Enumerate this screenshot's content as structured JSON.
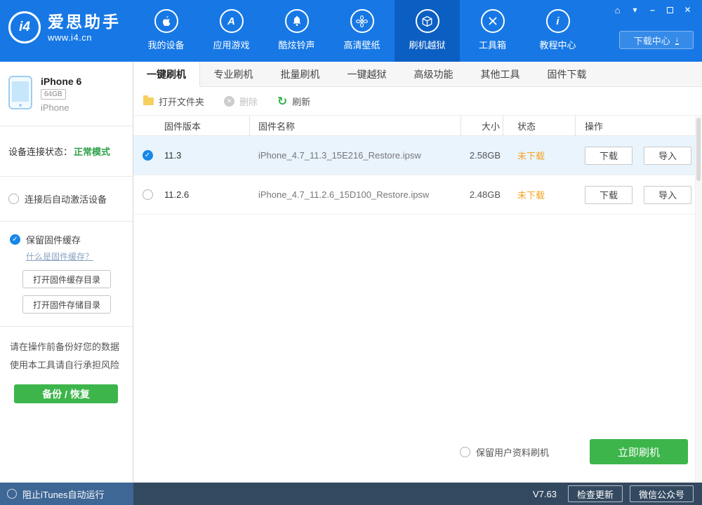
{
  "colors": {
    "topbar": "#1778e5",
    "topbar_active": "#0c5fc2",
    "green": "#3db54b",
    "status_green": "#2fa14b",
    "orange": "#f5a623",
    "selected_row": "#e9f4fd",
    "link": "#8aa4c2"
  },
  "titlebar": {
    "logo_text": "i4",
    "brand": "爱思助手",
    "site": "www.i4.cn",
    "download_center": "下载中心"
  },
  "nav": {
    "items": [
      {
        "label": "我的设备",
        "icon": "apple-icon"
      },
      {
        "label": "应用游戏",
        "icon": "app-store-icon"
      },
      {
        "label": "酷炫铃声",
        "icon": "bell-icon"
      },
      {
        "label": "高清壁纸",
        "icon": "flower-icon"
      },
      {
        "label": "刷机越狱",
        "icon": "package-box-icon",
        "active": true
      },
      {
        "label": "工具箱",
        "icon": "crossed-tools-icon"
      },
      {
        "label": "教程中心",
        "icon": "info-icon"
      }
    ]
  },
  "sidebar": {
    "device": {
      "name": "iPhone 6",
      "capacity": "64GB",
      "model": "iPhone"
    },
    "connection_label": "设备连接状态：",
    "connection_value": "正常模式",
    "auto_activate": "连接后自动激活设备",
    "keep_cache": "保留固件缓存",
    "cache_link": "什么是固件缓存？",
    "open_cache_dir": "打开固件缓存目录",
    "open_store_dir": "打开固件存储目录",
    "warning_line1": "请在操作前备份好您的数据",
    "warning_line2": "使用本工具请自行承担风险",
    "backup_restore": "备份 / 恢复"
  },
  "tabs": [
    "一键刷机",
    "专业刷机",
    "批量刷机",
    "一键越狱",
    "高级功能",
    "其他工具",
    "固件下载"
  ],
  "toolbar": {
    "open_folder": "打开文件夹",
    "delete": "删除",
    "refresh": "刷新"
  },
  "table": {
    "headers": {
      "version": "固件版本",
      "name": "固件名称",
      "size": "大小",
      "status": "状态",
      "operation": "操作"
    },
    "rows": [
      {
        "version": "11.3",
        "name": "iPhone_4.7_11.3_15E216_Restore.ipsw",
        "size": "2.58GB",
        "status": "未下载",
        "download": "下载",
        "import": "导入",
        "selected": true
      },
      {
        "version": "11.2.6",
        "name": "iPhone_4.7_11.2.6_15D100_Restore.ipsw",
        "size": "2.48GB",
        "status": "未下载",
        "download": "下载",
        "import": "导入",
        "selected": false
      }
    ]
  },
  "footer": {
    "keep_user_data": "保留用户资料刷机",
    "flash_now": "立即刷机"
  },
  "statusbar": {
    "block_itunes": "阻止iTunes自动运行",
    "version": "V7.63",
    "check_update": "检查更新",
    "wechat": "微信公众号"
  }
}
